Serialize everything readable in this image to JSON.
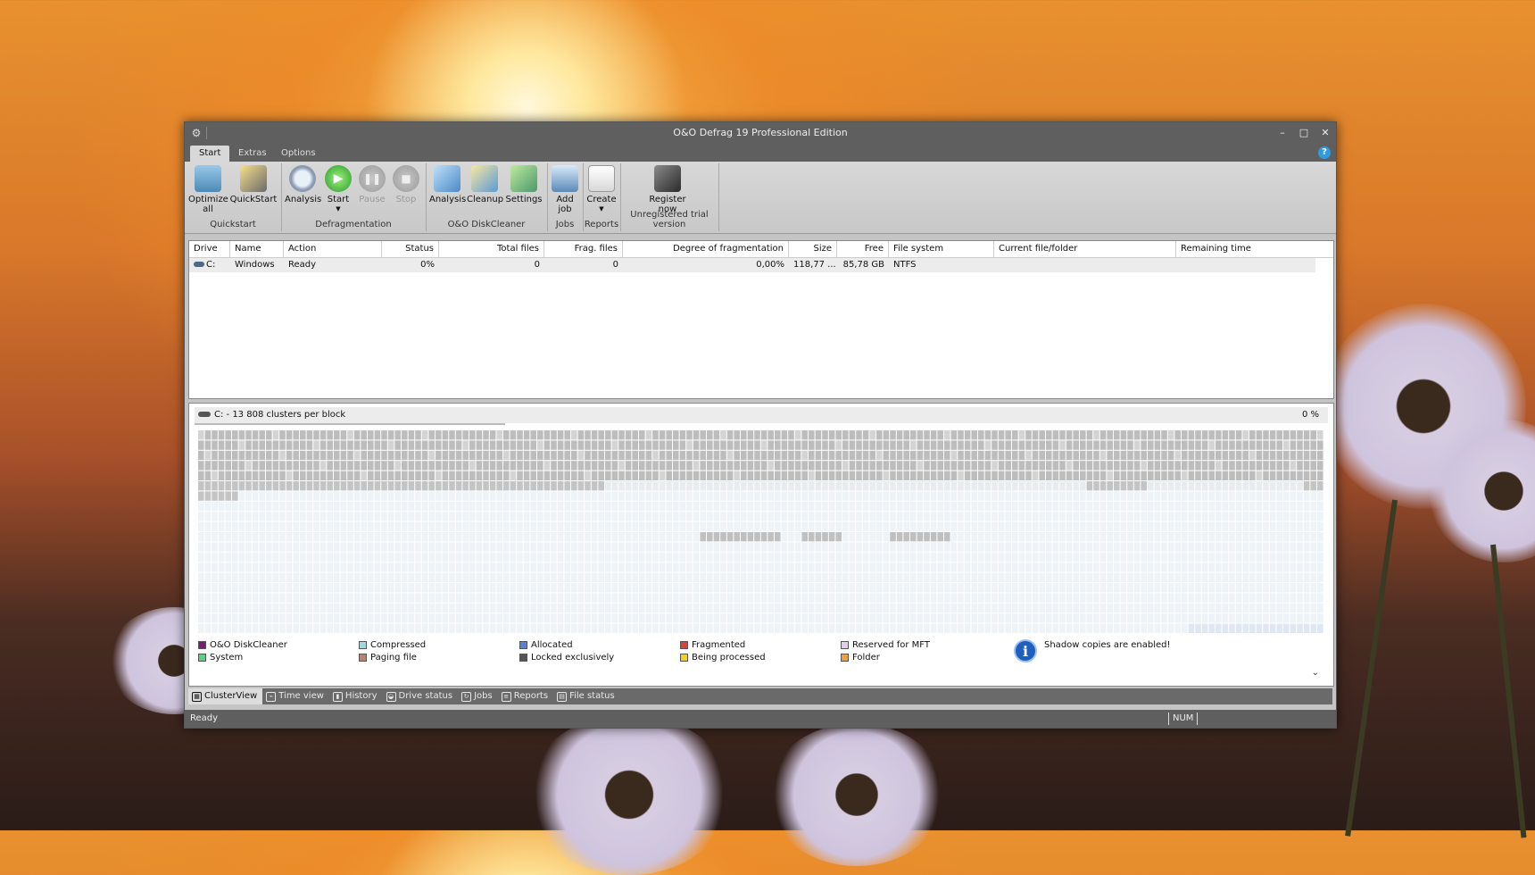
{
  "window": {
    "title": "O&O Defrag 19 Professional Edition",
    "controls": {
      "minimize": "–",
      "maximize": "□",
      "close": "✕"
    }
  },
  "tabs": [
    {
      "label": "Start",
      "active": true
    },
    {
      "label": "Extras",
      "active": false
    },
    {
      "label": "Options",
      "active": false
    }
  ],
  "ribbon": {
    "groups": {
      "quickstart": "Quickstart",
      "defragmentation": "Defragmentation",
      "diskcleaner": "O&O DiskCleaner",
      "jobs": "Jobs",
      "reports": "Reports",
      "trial": "Unregistered trial version"
    },
    "buttons": {
      "optimize_all_1": "Optimize",
      "optimize_all_2": "all",
      "quickstart": "QuickStart",
      "analysis": "Analysis",
      "start": "Start",
      "pause": "Pause",
      "stop": "Stop",
      "dc_analysis": "Analysis",
      "cleanup": "Cleanup",
      "settings": "Settings",
      "add_job_1": "Add",
      "add_job_2": "job",
      "create": "Create",
      "register_1": "Register",
      "register_2": "now"
    }
  },
  "drive_table": {
    "columns": [
      "Drive",
      "Name",
      "Action",
      "Status",
      "Total files",
      "Frag. files",
      "Degree of fragmentation",
      "Size",
      "Free",
      "File system",
      "Current file/folder",
      "Remaining time"
    ],
    "rows": [
      {
        "drive": "C:",
        "name": "Windows",
        "action": "Ready",
        "status": "0%",
        "total_files": "0",
        "frag_files": "0",
        "degree": "0,00%",
        "size": "118,77 ...",
        "free": "85,78 GB",
        "fs": "NTFS",
        "current": "",
        "remaining": ""
      }
    ]
  },
  "cluster": {
    "header": "C: - 13 808 clusters per block",
    "percent": "0 %"
  },
  "legend": [
    {
      "label": "O&O DiskCleaner",
      "color": "#7a1a7a"
    },
    {
      "label": "System",
      "color": "#5fcf80"
    },
    {
      "label": "Compressed",
      "color": "#9fd8e0"
    },
    {
      "label": "Paging file",
      "color": "#c08070"
    },
    {
      "label": "Allocated",
      "color": "#5a7fd8"
    },
    {
      "label": "Locked exclusively",
      "color": "#555555"
    },
    {
      "label": "Fragmented",
      "color": "#d84040"
    },
    {
      "label": "Being processed",
      "color": "#f0d020"
    },
    {
      "label": "Reserved for MFT",
      "color": "#e0d0e8"
    },
    {
      "label": "Folder",
      "color": "#f0a040"
    }
  ],
  "shadow_copies": "Shadow copies are enabled!",
  "view_tabs": [
    {
      "label": "ClusterView",
      "active": true
    },
    {
      "label": "Time view",
      "active": false
    },
    {
      "label": "History",
      "active": false
    },
    {
      "label": "Drive status",
      "active": false
    },
    {
      "label": "Jobs",
      "active": false
    },
    {
      "label": "Reports",
      "active": false
    },
    {
      "label": "File status",
      "active": false
    }
  ],
  "status": {
    "text": "Ready",
    "num": "NUM"
  }
}
